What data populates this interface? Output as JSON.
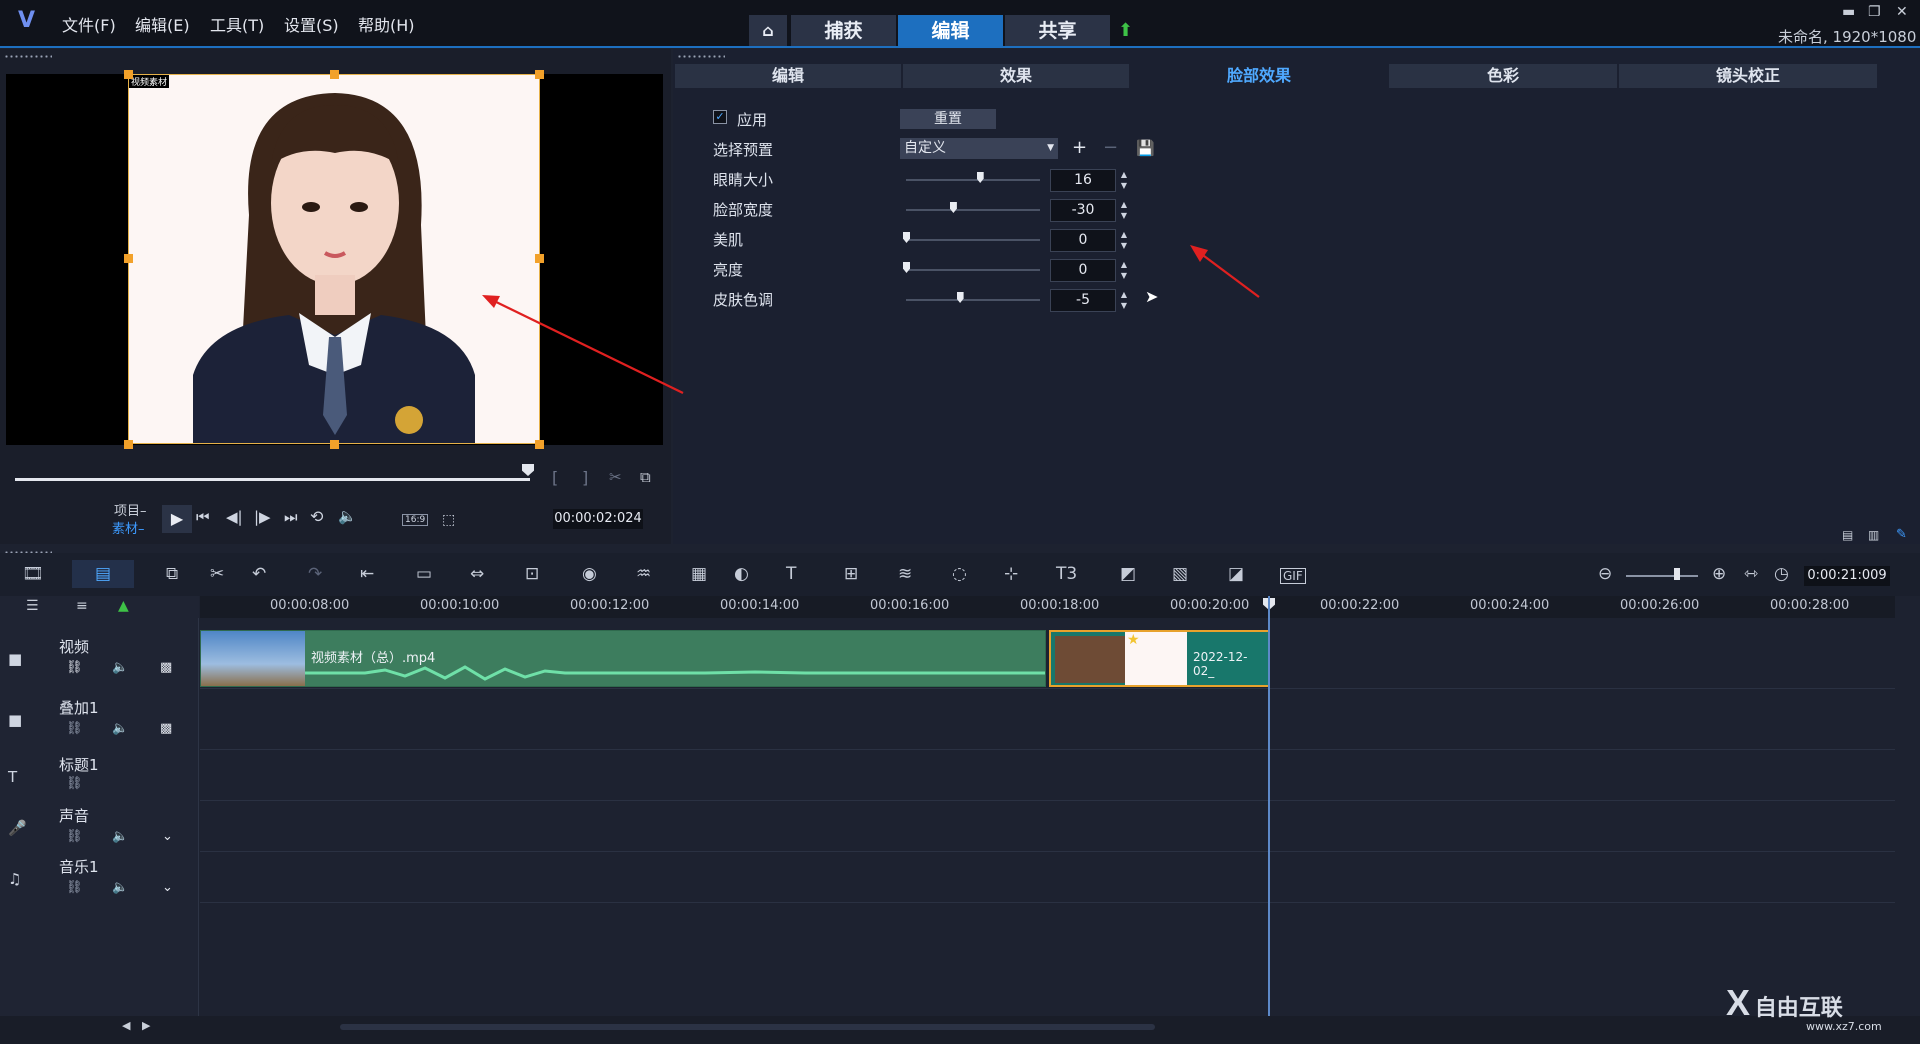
{
  "menu": [
    "文件(F)",
    "编辑(E)",
    "工具(T)",
    "设置(S)",
    "帮助(H)"
  ],
  "main_tabs": [
    "捕获",
    "编辑",
    "共享"
  ],
  "project_info": "未命名, 1920*1080",
  "sub_tabs": [
    "编辑",
    "效果",
    "脸部效果",
    "色彩",
    "镜头校正"
  ],
  "face": {
    "apply_label": "应用",
    "reset_label": "重置",
    "preset_label": "选择预置",
    "preset_value": "自定义",
    "rows": [
      {
        "label": "眼睛大小",
        "value": "16",
        "level": 0.55
      },
      {
        "label": "脸部宽度",
        "value": "-30",
        "level": 0.35
      },
      {
        "label": "美肌",
        "value": "0",
        "level": 0.0
      },
      {
        "label": "亮度",
        "value": "0",
        "level": 0.0
      },
      {
        "label": "皮肤色调",
        "value": "-5",
        "level": 0.4
      }
    ]
  },
  "preview": {
    "project_label": "项目",
    "clip_label": "素材",
    "timecode": "00:00:02:024",
    "aspect": "16:9",
    "watermark_tag": "视频素材"
  },
  "timeline": {
    "zoom_timecode": "0:00:21:009",
    "ticks": [
      "00:00:08:00",
      "00:00:10:00",
      "00:00:12:00",
      "00:00:14:00",
      "00:00:16:00",
      "00:00:18:00",
      "00:00:20:00",
      "00:00:22:00",
      "00:00:24:00",
      "00:00:26:00",
      "00:00:28:00"
    ],
    "tracks": [
      "视频",
      "叠加1",
      "标题1",
      "声音",
      "音乐1"
    ],
    "clip_main_label": "视频素材（总）.mp4",
    "clip_second_label": "2022-12-02_"
  },
  "watermark": {
    "brand": "自由互联",
    "url": "www.xz7.com"
  },
  "colors": {
    "accent": "#1d6fbf",
    "clip": "#3d7d5e",
    "arrow": "#e02020"
  }
}
